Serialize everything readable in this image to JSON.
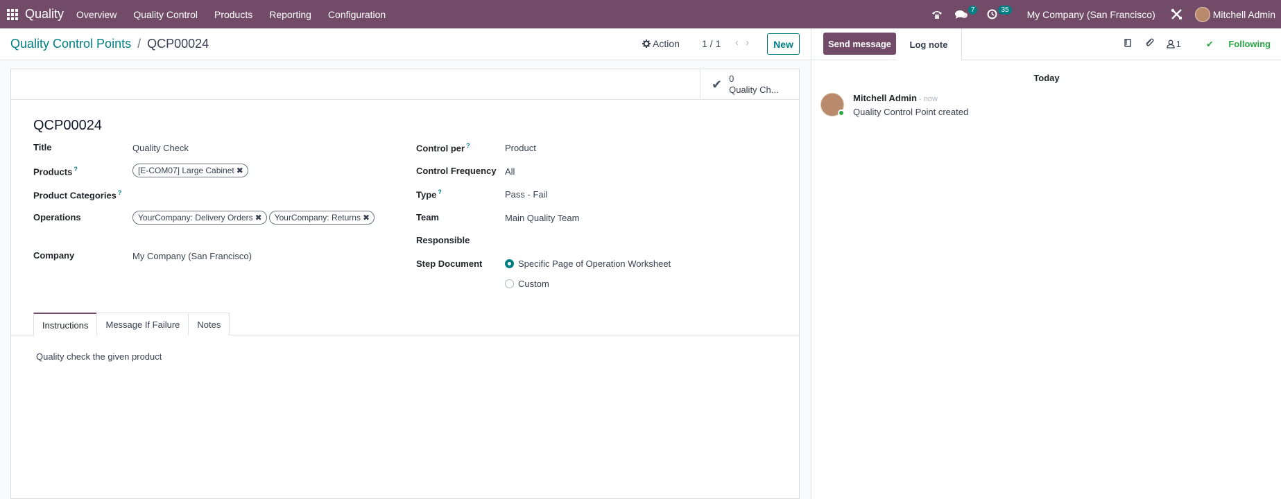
{
  "navbar": {
    "brand": "Quality",
    "menu": [
      "Overview",
      "Quality Control",
      "Products",
      "Reporting",
      "Configuration"
    ],
    "messages_count": "7",
    "activities_count": "35",
    "company": "My Company (San Francisco)",
    "user": "Mitchell Admin"
  },
  "control_panel": {
    "breadcrumb_parent": "Quality Control Points",
    "breadcrumb_sep": "/",
    "breadcrumb_current": "QCP00024",
    "action_label": "Action",
    "pager": "1 / 1",
    "new_label": "New"
  },
  "form": {
    "stat_value": "0",
    "stat_label": "Quality Ch...",
    "record_name": "QCP00024",
    "left": {
      "title_label": "Title",
      "title_value": "Quality Check",
      "products_label": "Products",
      "products_tags": [
        "[E-COM07] Large Cabinet"
      ],
      "product_categories_label": "Product Categories",
      "operations_label": "Operations",
      "operations_tags": [
        "YourCompany: Delivery Orders",
        "YourCompany: Returns"
      ],
      "company_label": "Company",
      "company_value": "My Company (San Francisco)"
    },
    "right": {
      "control_per_label": "Control per",
      "control_per_value": "Product",
      "control_frequency_label": "Control Frequency",
      "control_frequency_value": "All",
      "type_label": "Type",
      "type_value": "Pass - Fail",
      "team_label": "Team",
      "team_value": "Main Quality Team",
      "responsible_label": "Responsible",
      "step_document_label": "Step Document",
      "step_document_options": [
        "Specific Page of Operation Worksheet",
        "Custom"
      ],
      "step_document_selected": "Specific Page of Operation Worksheet"
    },
    "help_marker": "?",
    "tabs": [
      "Instructions",
      "Message If Failure",
      "Notes"
    ],
    "active_tab": "Instructions",
    "instructions_text": "Quality check the given product"
  },
  "chatter": {
    "send_message": "Send message",
    "log_note": "Log note",
    "followers_count": "1",
    "following_label": "Following",
    "date_separator": "Today",
    "message": {
      "author": "Mitchell Admin",
      "date": "- now",
      "body": "Quality Control Point created"
    }
  },
  "colors": {
    "brand": "#714b67",
    "accent": "#017e84",
    "following": "#28a745"
  }
}
